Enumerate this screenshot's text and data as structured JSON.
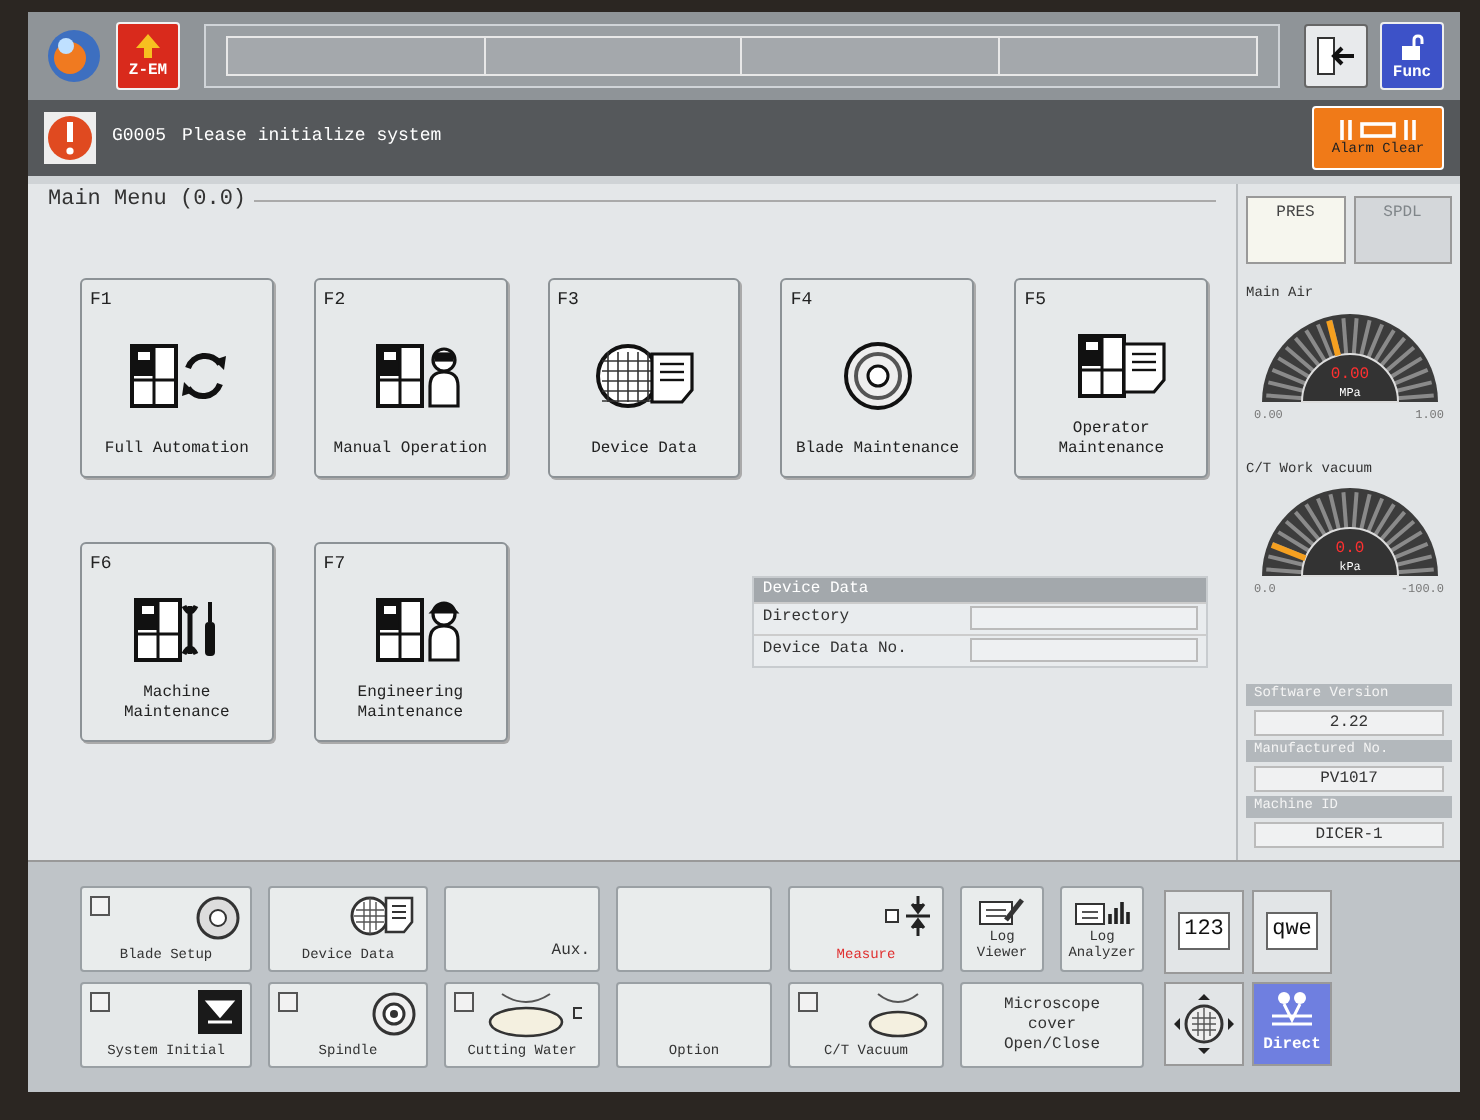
{
  "top_bar": {
    "zem_button": "Z-EM",
    "func_button": "Func"
  },
  "alarm": {
    "code": "G0005",
    "message": "Please initialize system",
    "clear_button": "Alarm Clear"
  },
  "main_menu": {
    "title": "Main Menu (0.0)",
    "tiles": [
      {
        "key": "F1",
        "label": "Full Automation",
        "kind": "auto"
      },
      {
        "key": "F2",
        "label": "Manual Operation",
        "kind": "manual"
      },
      {
        "key": "F3",
        "label": "Device Data",
        "kind": "device"
      },
      {
        "key": "F4",
        "label": "Blade Maintenance",
        "kind": "blade"
      },
      {
        "key": "F5",
        "label": "Operator Maintenance",
        "kind": "operator"
      },
      {
        "key": "F6",
        "label": "Machine Maintenance",
        "kind": "machine"
      },
      {
        "key": "F7",
        "label": "Engineering Maintenance",
        "kind": "engineering"
      }
    ],
    "device_data": {
      "title": "Device Data",
      "rows": [
        {
          "label": "Directory"
        },
        {
          "label": "Device Data No."
        }
      ]
    }
  },
  "side_panel": {
    "tabs": [
      {
        "label": "PRES",
        "selected": true
      },
      {
        "label": "SPDL",
        "selected": false
      }
    ],
    "gauges": [
      {
        "label": "Main Air",
        "reading": "0.00",
        "unit": "MPa",
        "min": "0.00",
        "max": "1.00",
        "level": 0.42
      },
      {
        "label": "C/T Work vacuum",
        "reading": "0.0",
        "unit": "kPa",
        "min": "0.0",
        "max": "-100.0",
        "level": 0.12
      }
    ],
    "info": [
      {
        "label": "Software Version",
        "value": "2.22"
      },
      {
        "label": "Manufactured No.",
        "value": "PV1017"
      },
      {
        "label": "Machine ID",
        "value": "DICER-1"
      }
    ]
  },
  "bottom_buttons": [
    {
      "label": "Blade Setup",
      "kind": "blade",
      "checked": false,
      "warning": false
    },
    {
      "label": "Device Data",
      "kind": "device",
      "warning": false
    },
    {
      "label": "Aux.",
      "kind": "aux",
      "warning": false
    },
    {
      "kind": "blank"
    },
    {
      "label": "Measure",
      "kind": "measure",
      "warning": true
    },
    {
      "label": "Log Viewer",
      "kind": "logviewer",
      "warning": false
    },
    {
      "label": "Log Analyzer",
      "kind": "loganalyzer",
      "warning": false
    },
    {
      "label": "System Initial",
      "kind": "system",
      "checked": false,
      "warning": false
    },
    {
      "label": "Spindle",
      "kind": "spindle",
      "checked": false,
      "warning": false
    },
    {
      "label": "Cutting Water",
      "kind": "water",
      "checked": false,
      "warning": false
    },
    {
      "label": "Option",
      "kind": "text",
      "warning": false
    },
    {
      "label": "C/T Vacuum",
      "kind": "vacuum",
      "checked": false,
      "warning": false
    },
    {
      "label": "Microscope cover Open/Close",
      "kind": "wide",
      "warning": false
    }
  ],
  "keypad": {
    "numeric_button": "123",
    "text_button": "qwe",
    "direct_button": "Direct"
  }
}
